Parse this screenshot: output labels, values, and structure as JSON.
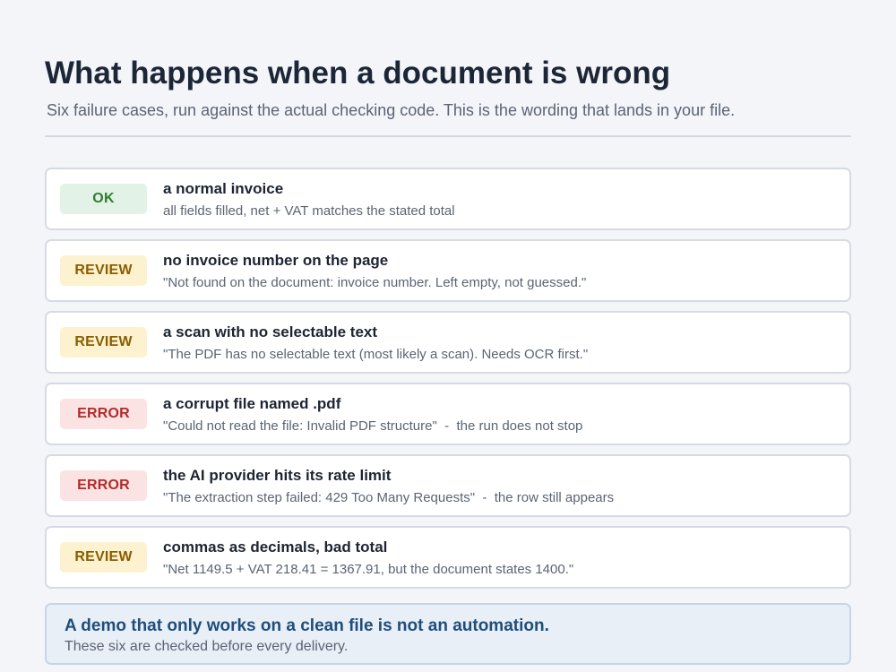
{
  "header": {
    "title": "What happens when a document is wrong",
    "subtitle": "Six failure cases, run against the actual checking code. This is the wording that lands in your file."
  },
  "cases": [
    {
      "status": "OK",
      "status_color": "#2e7d32",
      "title": "a normal invoice",
      "detail": "all fields filled, net + VAT matches the stated total"
    },
    {
      "status": "REVIEW",
      "status_color": "#8a5d00",
      "title": "no invoice number on the page",
      "detail": "\"Not found on the document: invoice number. Left empty, not guessed.\""
    },
    {
      "status": "REVIEW",
      "status_color": "#8a5d00",
      "title": "a scan with no selectable text",
      "detail": "\"The PDF has no selectable text (most likely a scan). Needs OCR first.\""
    },
    {
      "status": "ERROR",
      "status_color": "#b32a2a",
      "title": "a corrupt file named .pdf",
      "detail": "\"Could not read the file: Invalid PDF structure\"  -  the run does not stop"
    },
    {
      "status": "ERROR",
      "status_color": "#b32a2a",
      "title": "the AI provider hits its rate limit",
      "detail": "\"The extraction step failed: 429 Too Many Requests\"  -  the row still appears"
    },
    {
      "status": "REVIEW",
      "status_color": "#8a5d00",
      "title": "commas as decimals, bad total",
      "detail": "\"Net 1149.5 + VAT 218.41 = 1367.91, but the document states 1400.\""
    }
  ],
  "callout": {
    "title": "A demo that only works on a clean file is not an automation.",
    "text": "These six are checked before every delivery."
  }
}
